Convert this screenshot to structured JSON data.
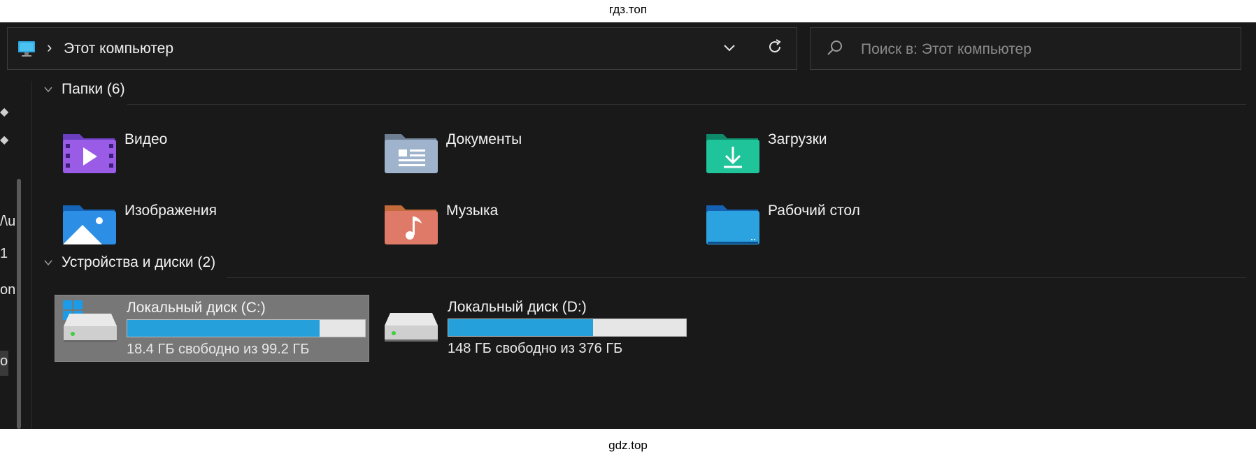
{
  "watermark_top": "гдз.топ",
  "watermark_bottom": "gdz.top",
  "address": {
    "location": "Этот компьютер",
    "separator": "›"
  },
  "search": {
    "placeholder": "Поиск в: Этот компьютер"
  },
  "sidebar_fragments": [
    "/\\u",
    "1",
    "on",
    "o"
  ],
  "groups": {
    "folders": {
      "title": "Папки (6)"
    },
    "devices": {
      "title": "Устройства и диски (2)"
    }
  },
  "folders": [
    {
      "name": "Видео",
      "icon": "videos-folder-icon"
    },
    {
      "name": "Документы",
      "icon": "documents-folder-icon"
    },
    {
      "name": "Загрузки",
      "icon": "downloads-folder-icon"
    },
    {
      "name": "Изображения",
      "icon": "pictures-folder-icon"
    },
    {
      "name": "Музыка",
      "icon": "music-folder-icon"
    },
    {
      "name": "Рабочий стол",
      "icon": "desktop-folder-icon"
    }
  ],
  "drives": [
    {
      "name": "Локальный диск (C:)",
      "free_text": "18.4 ГБ свободно из 99.2 ГБ",
      "used_fraction": 0.81,
      "selected": true,
      "system": true
    },
    {
      "name": "Локальный диск (D:)",
      "free_text": "148 ГБ свободно из 376 ГБ",
      "used_fraction": 0.61,
      "selected": false,
      "system": false
    }
  ],
  "colors": {
    "accent": "#26a0da",
    "background": "#191919",
    "selection": "#777777"
  }
}
